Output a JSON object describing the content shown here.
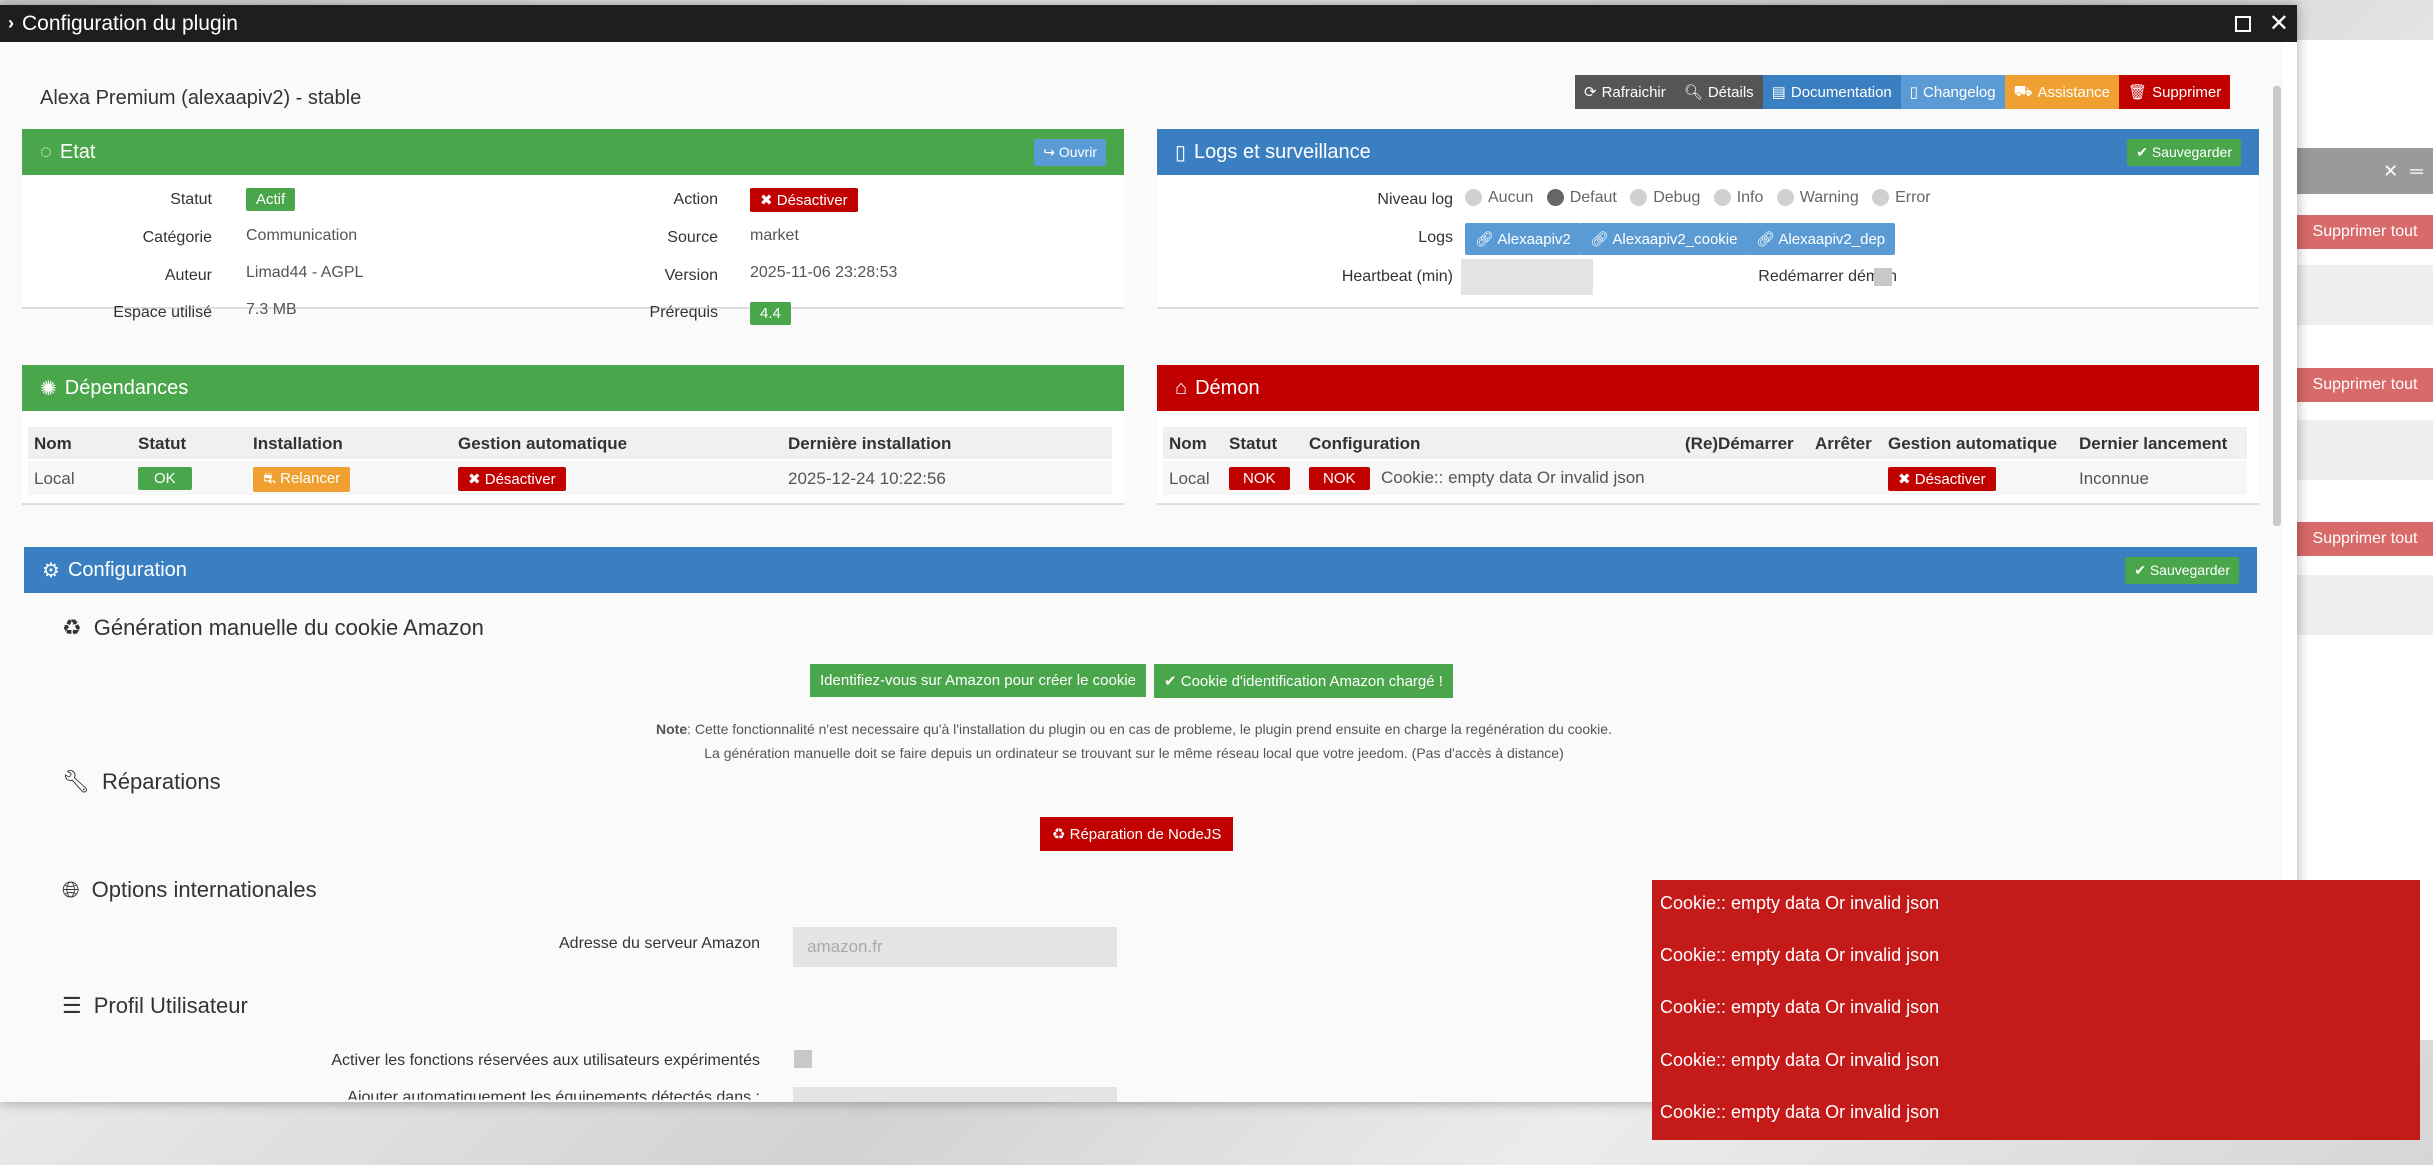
{
  "window": {
    "title": "Configuration du plugin"
  },
  "plugin": {
    "title": "Alexa Premium (alexaapiv2) - stable"
  },
  "toolbar": {
    "refresh": "Rafraichir",
    "details": "Détails",
    "documentation": "Documentation",
    "changelog": "Changelog",
    "assistance": "Assistance",
    "delete": "Supprimer"
  },
  "etat": {
    "title": "Etat",
    "open": "Ouvrir",
    "statut_label": "Statut",
    "statut_value": "Actif",
    "categorie_label": "Catégorie",
    "categorie_value": "Communication",
    "auteur_label": "Auteur",
    "auteur_value": "Limad44 - AGPL",
    "espace_label": "Espace utilisé",
    "espace_value": "7.3 MB",
    "action_label": "Action",
    "action_value": "Désactiver",
    "source_label": "Source",
    "source_value": "market",
    "version_label": "Version",
    "version_value": "2025-11-06 23:28:53",
    "prerequis_label": "Prérequis",
    "prerequis_value": "4.4"
  },
  "logs": {
    "title": "Logs et surveillance",
    "save": "Sauvegarder",
    "niveau_label": "Niveau log",
    "levels": [
      "Aucun",
      "Defaut",
      "Debug",
      "Info",
      "Warning",
      "Error"
    ],
    "logs_label": "Logs",
    "log_files": [
      "Alexaapiv2",
      "Alexaapiv2_cookie",
      "Alexaapiv2_dep"
    ],
    "heartbeat_label": "Heartbeat (min)",
    "restart_label": "Redémarrer démon"
  },
  "deps": {
    "title": "Dépendances",
    "headers": [
      "Nom",
      "Statut",
      "Installation",
      "Gestion automatique",
      "Dernière installation"
    ],
    "row": {
      "nom": "Local",
      "statut": "OK",
      "installation": "Relancer",
      "gestion": "Désactiver",
      "derniere": "2025-12-24 10:22:56"
    }
  },
  "demon": {
    "title": "Démon",
    "headers": [
      "Nom",
      "Statut",
      "Configuration",
      "(Re)Démarrer",
      "Arrêter",
      "Gestion automatique",
      "Dernier lancement"
    ],
    "row": {
      "nom": "Local",
      "statut": "NOK",
      "config_badge": "NOK",
      "config_text": "Cookie:: empty data Or invalid json",
      "gestion": "Désactiver",
      "dernier": "Inconnue"
    }
  },
  "config": {
    "title": "Configuration",
    "save": "Sauvegarder",
    "cookie_section": "Génération manuelle du cookie Amazon",
    "btn_identify": "Identifiez-vous sur Amazon pour créer le cookie",
    "btn_cookie_loaded": "Cookie d'identification Amazon chargé !",
    "note_bold": "Note",
    "note_line1": ": Cette fonctionnalité n'est necessaire qu'à l'installation du plugin ou en cas de probleme, le plugin prend ensuite en charge la regénération du cookie.",
    "note_line2": "La génération manuelle doit se faire depuis un ordinateur se trouvant sur le même réseau local que votre jeedom. (Pas d'accès à distance)",
    "repair_section": "Réparations",
    "btn_repair": "Réparation de NodeJS",
    "intl_section": "Options internationales",
    "server_label": "Adresse du serveur Amazon",
    "server_placeholder": "amazon.fr",
    "profile_section": "Profil Utilisateur",
    "expert_label": "Activer les fonctions réservées aux utilisateurs expérimentés",
    "auto_label": "Ajouter automatiquement les équipements détectés dans :"
  },
  "background": {
    "delete_all": "Supprimer tout"
  },
  "toasts": [
    "Cookie:: empty data Or invalid json",
    "Cookie:: empty data Or invalid json",
    "Cookie:: empty data Or invalid json",
    "Cookie:: empty data Or invalid json",
    "Cookie:: empty data Or invalid json"
  ],
  "colors": {
    "green": "#4aa64a",
    "blue": "#3a7fc1",
    "red": "#c10000",
    "orange": "#f0a030",
    "light_blue": "#5b9bd5",
    "dark": "#555555"
  }
}
